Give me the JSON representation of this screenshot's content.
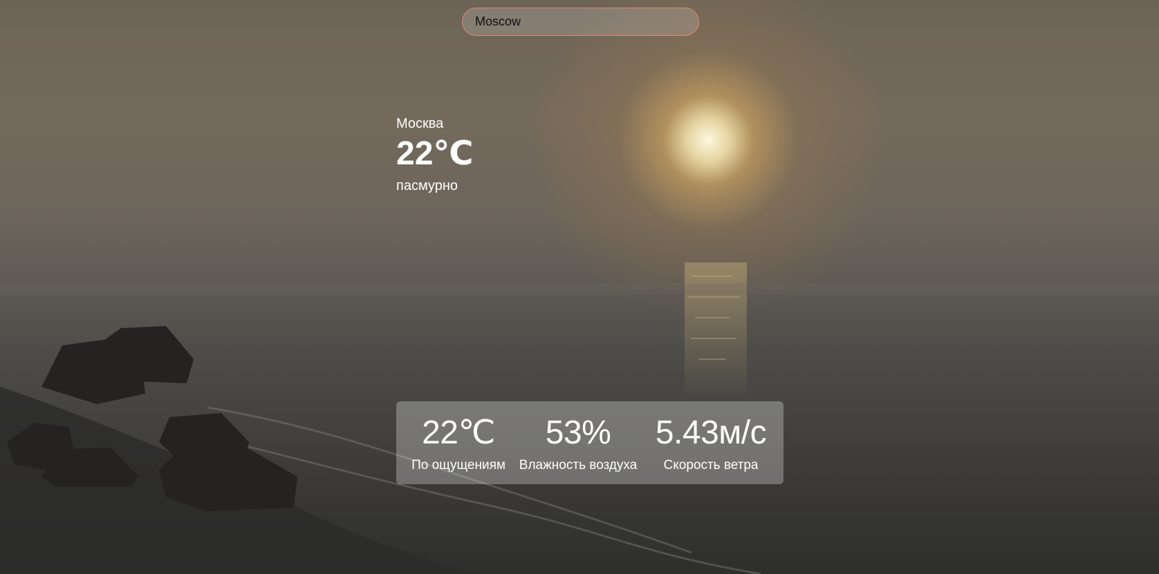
{
  "search": {
    "value": "Moscow"
  },
  "current": {
    "city": "Москва",
    "temperature": "22℃",
    "description": "пасмурно"
  },
  "details": [
    {
      "value": "22℃",
      "label": "По ощущениям"
    },
    {
      "value": "53%",
      "label": "Влажность воздуха"
    },
    {
      "value": "5.43м/с",
      "label": "Скорость ветра"
    }
  ],
  "colors": {
    "search_border": "#e7866d",
    "text": "#ffffff"
  }
}
